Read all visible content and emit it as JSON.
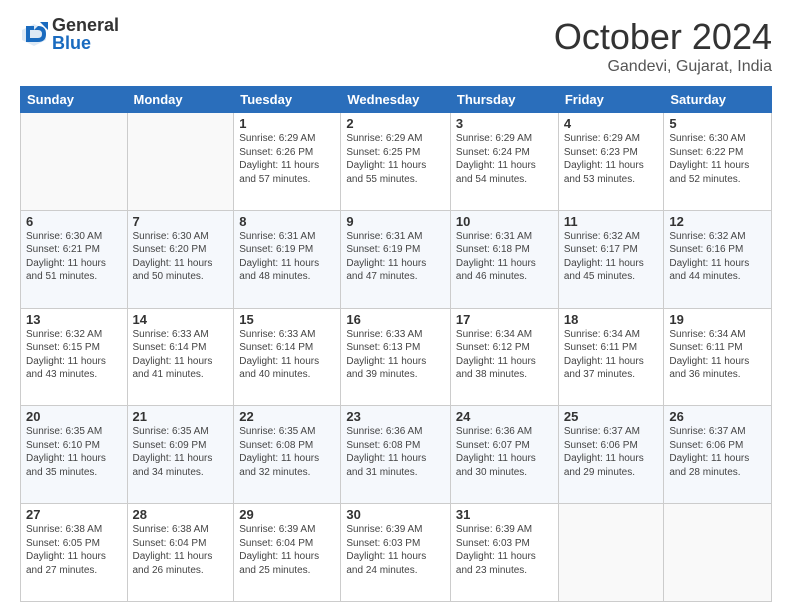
{
  "header": {
    "logo_general": "General",
    "logo_blue": "Blue",
    "month": "October 2024",
    "location": "Gandevi, Gujarat, India"
  },
  "weekdays": [
    "Sunday",
    "Monday",
    "Tuesday",
    "Wednesday",
    "Thursday",
    "Friday",
    "Saturday"
  ],
  "weeks": [
    [
      {
        "day": "",
        "info": ""
      },
      {
        "day": "",
        "info": ""
      },
      {
        "day": "1",
        "info": "Sunrise: 6:29 AM\nSunset: 6:26 PM\nDaylight: 11 hours and 57 minutes."
      },
      {
        "day": "2",
        "info": "Sunrise: 6:29 AM\nSunset: 6:25 PM\nDaylight: 11 hours and 55 minutes."
      },
      {
        "day": "3",
        "info": "Sunrise: 6:29 AM\nSunset: 6:24 PM\nDaylight: 11 hours and 54 minutes."
      },
      {
        "day": "4",
        "info": "Sunrise: 6:29 AM\nSunset: 6:23 PM\nDaylight: 11 hours and 53 minutes."
      },
      {
        "day": "5",
        "info": "Sunrise: 6:30 AM\nSunset: 6:22 PM\nDaylight: 11 hours and 52 minutes."
      }
    ],
    [
      {
        "day": "6",
        "info": "Sunrise: 6:30 AM\nSunset: 6:21 PM\nDaylight: 11 hours and 51 minutes."
      },
      {
        "day": "7",
        "info": "Sunrise: 6:30 AM\nSunset: 6:20 PM\nDaylight: 11 hours and 50 minutes."
      },
      {
        "day": "8",
        "info": "Sunrise: 6:31 AM\nSunset: 6:19 PM\nDaylight: 11 hours and 48 minutes."
      },
      {
        "day": "9",
        "info": "Sunrise: 6:31 AM\nSunset: 6:19 PM\nDaylight: 11 hours and 47 minutes."
      },
      {
        "day": "10",
        "info": "Sunrise: 6:31 AM\nSunset: 6:18 PM\nDaylight: 11 hours and 46 minutes."
      },
      {
        "day": "11",
        "info": "Sunrise: 6:32 AM\nSunset: 6:17 PM\nDaylight: 11 hours and 45 minutes."
      },
      {
        "day": "12",
        "info": "Sunrise: 6:32 AM\nSunset: 6:16 PM\nDaylight: 11 hours and 44 minutes."
      }
    ],
    [
      {
        "day": "13",
        "info": "Sunrise: 6:32 AM\nSunset: 6:15 PM\nDaylight: 11 hours and 43 minutes."
      },
      {
        "day": "14",
        "info": "Sunrise: 6:33 AM\nSunset: 6:14 PM\nDaylight: 11 hours and 41 minutes."
      },
      {
        "day": "15",
        "info": "Sunrise: 6:33 AM\nSunset: 6:14 PM\nDaylight: 11 hours and 40 minutes."
      },
      {
        "day": "16",
        "info": "Sunrise: 6:33 AM\nSunset: 6:13 PM\nDaylight: 11 hours and 39 minutes."
      },
      {
        "day": "17",
        "info": "Sunrise: 6:34 AM\nSunset: 6:12 PM\nDaylight: 11 hours and 38 minutes."
      },
      {
        "day": "18",
        "info": "Sunrise: 6:34 AM\nSunset: 6:11 PM\nDaylight: 11 hours and 37 minutes."
      },
      {
        "day": "19",
        "info": "Sunrise: 6:34 AM\nSunset: 6:11 PM\nDaylight: 11 hours and 36 minutes."
      }
    ],
    [
      {
        "day": "20",
        "info": "Sunrise: 6:35 AM\nSunset: 6:10 PM\nDaylight: 11 hours and 35 minutes."
      },
      {
        "day": "21",
        "info": "Sunrise: 6:35 AM\nSunset: 6:09 PM\nDaylight: 11 hours and 34 minutes."
      },
      {
        "day": "22",
        "info": "Sunrise: 6:35 AM\nSunset: 6:08 PM\nDaylight: 11 hours and 32 minutes."
      },
      {
        "day": "23",
        "info": "Sunrise: 6:36 AM\nSunset: 6:08 PM\nDaylight: 11 hours and 31 minutes."
      },
      {
        "day": "24",
        "info": "Sunrise: 6:36 AM\nSunset: 6:07 PM\nDaylight: 11 hours and 30 minutes."
      },
      {
        "day": "25",
        "info": "Sunrise: 6:37 AM\nSunset: 6:06 PM\nDaylight: 11 hours and 29 minutes."
      },
      {
        "day": "26",
        "info": "Sunrise: 6:37 AM\nSunset: 6:06 PM\nDaylight: 11 hours and 28 minutes."
      }
    ],
    [
      {
        "day": "27",
        "info": "Sunrise: 6:38 AM\nSunset: 6:05 PM\nDaylight: 11 hours and 27 minutes."
      },
      {
        "day": "28",
        "info": "Sunrise: 6:38 AM\nSunset: 6:04 PM\nDaylight: 11 hours and 26 minutes."
      },
      {
        "day": "29",
        "info": "Sunrise: 6:39 AM\nSunset: 6:04 PM\nDaylight: 11 hours and 25 minutes."
      },
      {
        "day": "30",
        "info": "Sunrise: 6:39 AM\nSunset: 6:03 PM\nDaylight: 11 hours and 24 minutes."
      },
      {
        "day": "31",
        "info": "Sunrise: 6:39 AM\nSunset: 6:03 PM\nDaylight: 11 hours and 23 minutes."
      },
      {
        "day": "",
        "info": ""
      },
      {
        "day": "",
        "info": ""
      }
    ]
  ]
}
